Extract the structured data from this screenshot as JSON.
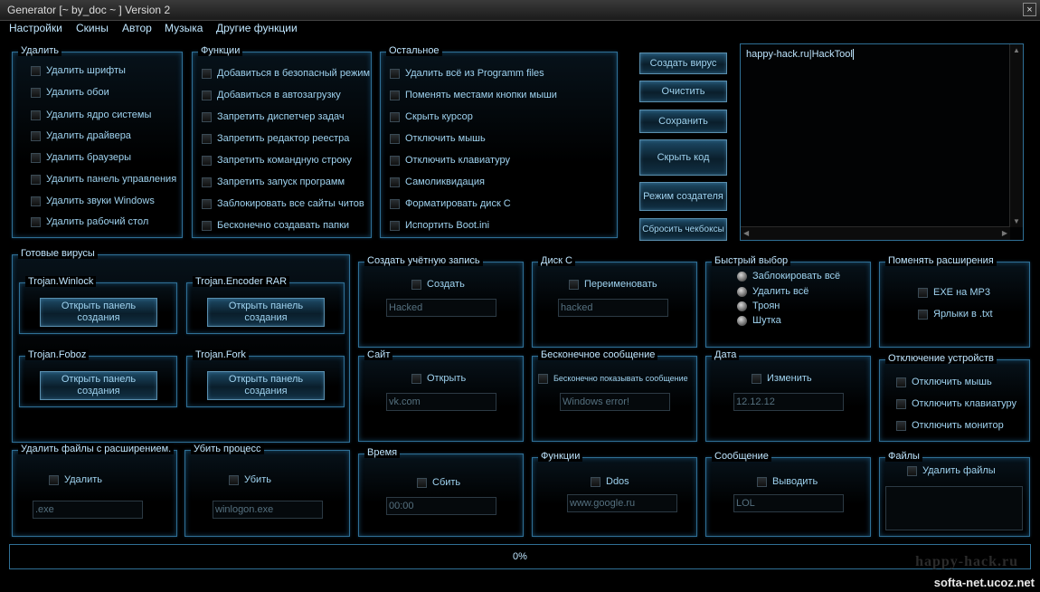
{
  "window": {
    "title": "Generator [~ by_doc ~ ] Version 2",
    "close": "×"
  },
  "menu": [
    "Настройки",
    "Скины",
    "Автор",
    "Музыка",
    "Другие функции"
  ],
  "delete_panel": {
    "title": "Удалить",
    "items": [
      "Удалить шрифты",
      "Удалить обои",
      "Удалить ядро системы",
      "Удалить драйвера",
      "Удалить браузеры",
      "Удалить панель управления",
      "Удалить звуки Windows",
      "Удалить рабочий стол"
    ]
  },
  "functions_panel": {
    "title": "Функции",
    "items": [
      "Добавиться в безопасный режим",
      "Добавиться в автозагрузку",
      "Запретить диспетчер задач",
      "Запретить редактор реестра",
      "Запретить командную строку",
      "Запретить запуск программ",
      "Заблокировать все сайты читов",
      "Бесконечно создавать папки"
    ]
  },
  "other_panel": {
    "title": "Остальное",
    "items": [
      "Удалить всё из Programm files",
      "Поменять местами кнопки мыши",
      "Скрыть курсор",
      "Отключить мышь",
      "Отключить клавиатуру",
      "Самоликвидация",
      "Форматировать диск C",
      "Испортить Boot.ini"
    ]
  },
  "action_buttons": [
    "Создать вирус",
    "Очистить",
    "Сохранить",
    "Скрыть код",
    "Режим создателя",
    "Сбросить чекбоксы"
  ],
  "editor": {
    "text": "happy-hack.ru|HackTool"
  },
  "ready_viruses": {
    "title": "Готовые вирусы",
    "groups": [
      {
        "title": "Trojan.Winlock",
        "button": "Открыть панель создания"
      },
      {
        "title": "Trojan.Encoder RAR",
        "button": "Открыть панель создания"
      },
      {
        "title": "Trojan.Foboz",
        "button": "Открыть панель создания"
      },
      {
        "title": "Trojan.Fork",
        "button": "Открыть панель создания"
      }
    ]
  },
  "account": {
    "title": "Создать учётную запись",
    "check": "Создать",
    "value": "Hacked"
  },
  "disk": {
    "title": "Диск C",
    "check": "Переименовать",
    "value": "hacked"
  },
  "quick": {
    "title": "Быстрый выбор",
    "options": [
      "Заблокировать всё",
      "Удалить всё",
      "Троян",
      "Шутка"
    ]
  },
  "extensions": {
    "title": "Поменять расширения",
    "items": [
      "EXE на MP3",
      "Ярлыки в .txt"
    ]
  },
  "site": {
    "title": "Сайт",
    "check": "Открыть",
    "value": "vk.com"
  },
  "endless": {
    "title": "Бесконечное сообщение",
    "check": "Бесконечно показывать сообщение",
    "value": "Windows error!"
  },
  "date": {
    "title": "Дата",
    "check": "Изменить",
    "value": "12.12.12"
  },
  "devices": {
    "title": "Отключение устройств",
    "items": [
      "Отключить мышь",
      "Отключить клавиатуру",
      "Отключить монитор"
    ]
  },
  "del_ext": {
    "title": "Удалить файлы с расширением.",
    "check": "Удалить",
    "value": ".exe"
  },
  "kill": {
    "title": "Убить процесс",
    "check": "Убить",
    "value": "winlogon.exe"
  },
  "time": {
    "title": "Время",
    "check": "Сбить",
    "value": "00:00"
  },
  "functions2": {
    "title": "Функции",
    "check": "Ddos",
    "value": "www.google.ru"
  },
  "message": {
    "title": "Сообщение",
    "check": "Выводить",
    "value": "LOL"
  },
  "files": {
    "title": "Файлы",
    "check": "Удалить файлы"
  },
  "progress": {
    "label": "0%",
    "value": 0
  },
  "watermarks": {
    "site1": "happy-hack.ru",
    "site2": "softa-net.ucoz.net"
  },
  "colors": {
    "accent": "#2f6f95",
    "text": "#9fd3f0",
    "background": "#000000"
  }
}
